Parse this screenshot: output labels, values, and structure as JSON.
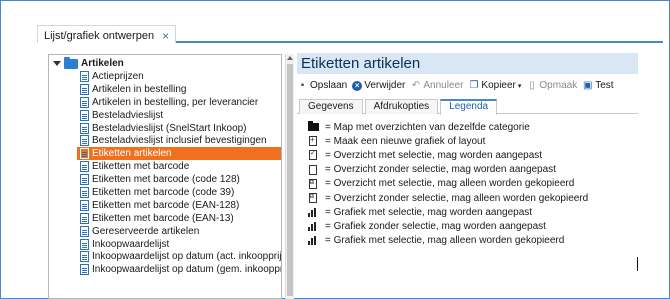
{
  "window_tab": {
    "label": "Lijst/grafiek ontwerpen",
    "close": "×"
  },
  "tree": {
    "root_label": "Artikelen",
    "items": [
      "Actieprijzen",
      "Artikelen in bestelling",
      "Artikelen in bestelling, per leverancier",
      "Besteladvieslijst",
      "Besteladvieslijst (SnelStart Inkoop)",
      "Besteladvieslijst inclusief bevestigingen",
      "Etiketten artikelen",
      "Etiketten met barcode",
      "Etiketten met barcode (code 128)",
      "Etiketten met barcode (code 39)",
      "Etiketten met barcode (EAN-128)",
      "Etiketten met barcode (EAN-13)",
      "Gereserveerde artikelen",
      "Inkoopwaardelijst",
      "Inkoopwaardelijst op datum (act. inkoopprijs)",
      "Inkoopwaardelijst op datum (gem. inkoopprijs)"
    ],
    "selected_index": 6
  },
  "detail": {
    "title": "Etiketten artikelen",
    "toolbar": {
      "save": "Opslaan",
      "delete": "Verwijder",
      "undo": "Annuleer",
      "copy": "Kopieer",
      "format": "Opmaak",
      "test": "Test"
    },
    "tabs": [
      "Gegevens",
      "Afdrukopties",
      "Legenda"
    ],
    "active_tab": "Legenda",
    "legend": [
      {
        "icon": "folder-icon",
        "text": "= Map met overzichten van dezelfde categorie"
      },
      {
        "icon": "new-document-icon",
        "text": "= Maak een nieuwe grafiek of layout"
      },
      {
        "icon": "document-edit-icon",
        "text": "= Overzicht met selectie, mag worden aangepast"
      },
      {
        "icon": "document-icon",
        "text": "= Overzicht zonder selectie, mag worden aangepast"
      },
      {
        "icon": "document-copy-icon",
        "text": "= Overzicht met selectie, mag alleen worden gekopieerd"
      },
      {
        "icon": "document-copy-icon",
        "text": "= Overzicht zonder selectie, mag alleen worden gekopieerd"
      },
      {
        "icon": "chart-edit-icon",
        "text": "= Grafiek met selectie, mag worden aangepast"
      },
      {
        "icon": "chart-icon",
        "text": "= Grafiek zonder selectie, mag worden aangepast"
      },
      {
        "icon": "chart-copy-icon",
        "text": "= Grafiek met selectie, mag alleen worden gekopieerd"
      }
    ]
  },
  "colors": {
    "accent": "#4a86c8",
    "selected": "#f07020",
    "title_bg": "#d8e6f5"
  }
}
